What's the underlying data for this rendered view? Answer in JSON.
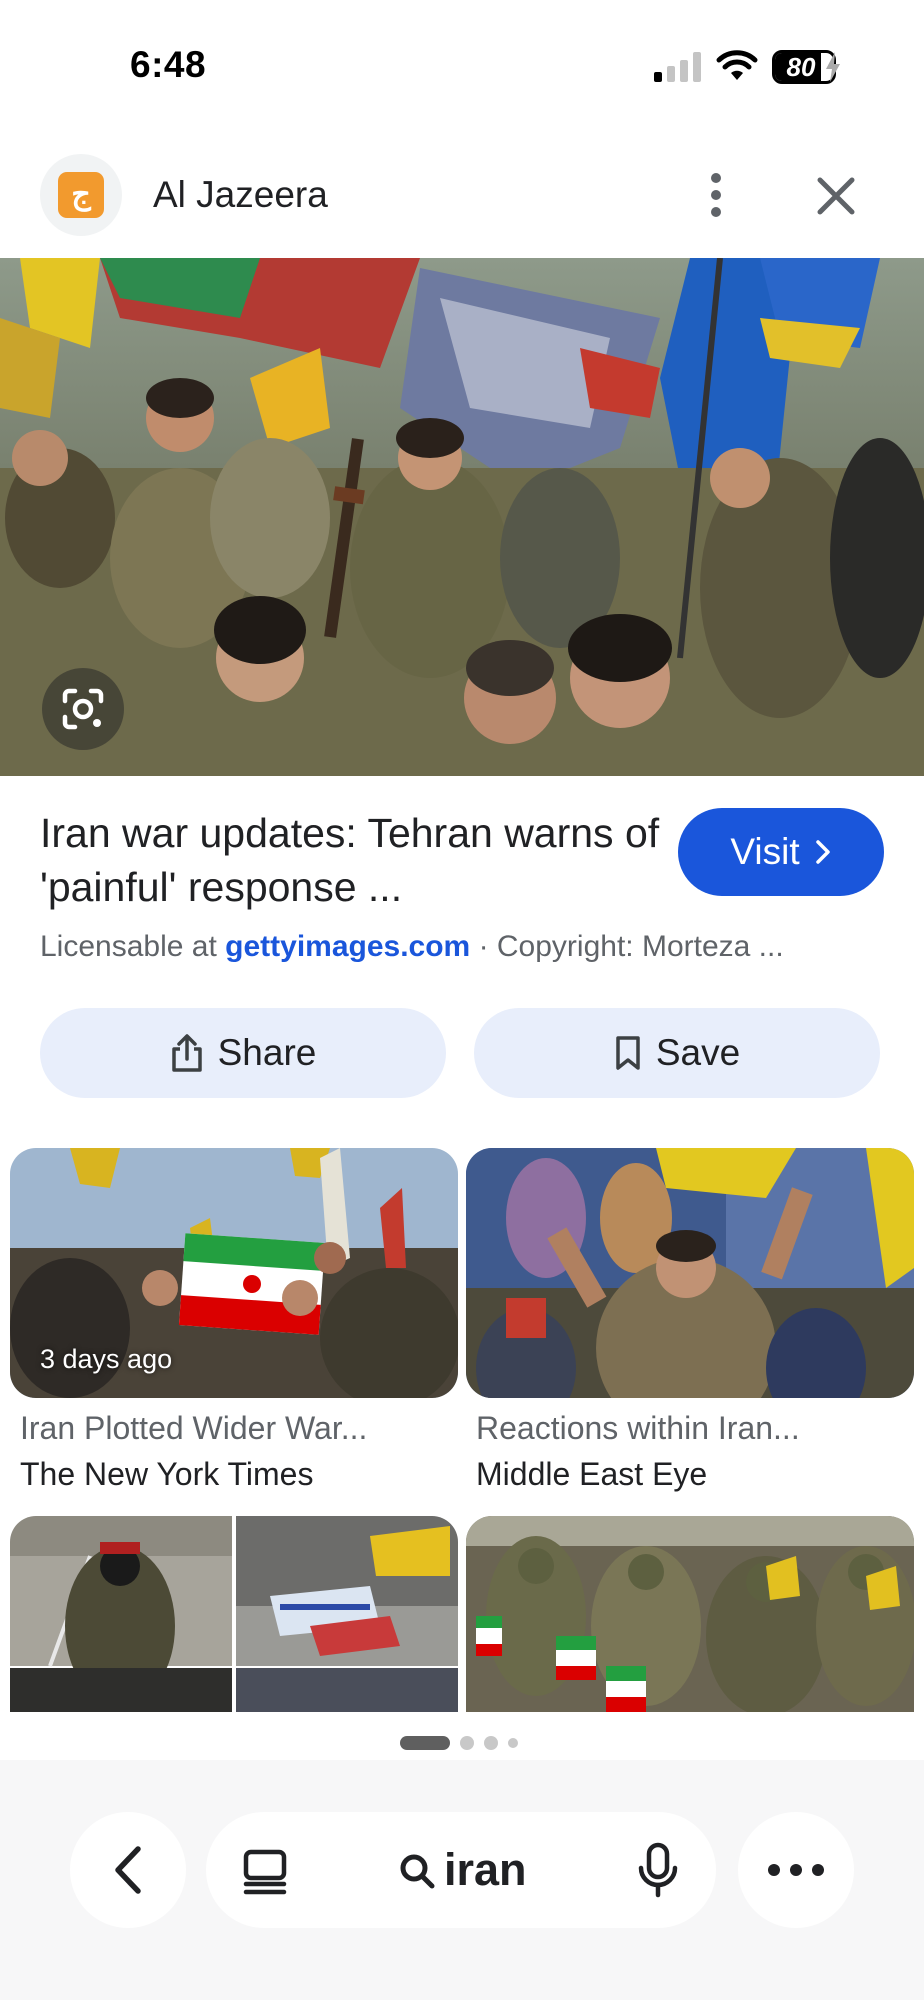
{
  "status_bar": {
    "time": "6:48",
    "battery": "80",
    "battery_level_percent": 80
  },
  "header": {
    "source_name": "Al Jazeera",
    "logo_icon": "al-jazeera-logo"
  },
  "result": {
    "title": "Iran war updates: Tehran warns of 'painful' response ...",
    "visit_label": "Visit",
    "license_prefix": "Licensable at ",
    "license_link": "gettyimages.com",
    "copyright": " · Copyright: Morteza ..."
  },
  "actions": {
    "share_label": "Share",
    "save_label": "Save"
  },
  "related": [
    {
      "title": "Iran Plotted Wider War...",
      "source": "The New York Times",
      "badge": "3 days ago"
    },
    {
      "title": "Reactions within Iran...",
      "source": "Middle East Eye"
    }
  ],
  "bottom_bar": {
    "query": "iran"
  },
  "colors": {
    "accent": "#1a56db",
    "chip_bg": "#e8eefb",
    "logo_orange": "#f29a2e"
  }
}
